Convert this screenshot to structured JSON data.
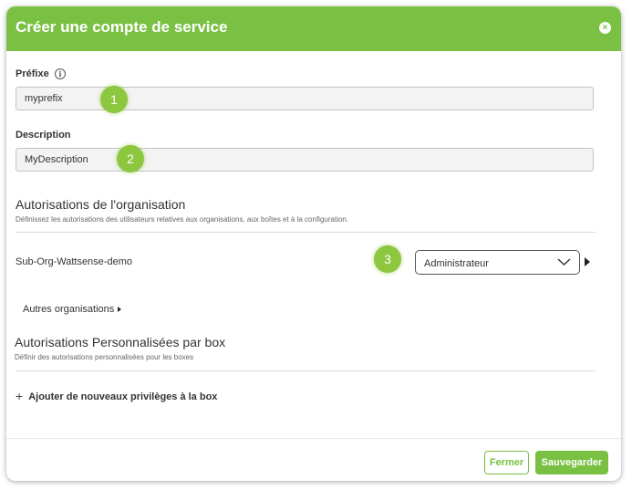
{
  "header": {
    "title": "Créer une compte de service",
    "close_icon": "close-icon",
    "close_symbol": "×",
    "accent_color": "#7ac143"
  },
  "prefix_field": {
    "label": "Préfixe",
    "info_symbol": "i",
    "value": "myprefix",
    "step": "1"
  },
  "description_field": {
    "label": "Description",
    "value": "MyDescription",
    "step": "2"
  },
  "org_permissions": {
    "title": "Autorisations de l'organisation",
    "subtitle": "Définissez les autorisations des utilisateurs relatives aux organisations, aux boîtes et à la configuration.",
    "org_name": "Sub-Org-Wattsense-demo",
    "role": "Administrateur",
    "step": "3",
    "other_orgs_label": "Autres organisations"
  },
  "box_permissions": {
    "title": "Autorisations Personnalisées par box",
    "subtitle": "Définir des autorisations personnalisées pour les boxes",
    "add_label": "Ajouter de nouveaux privilèges à la box",
    "add_symbol": "+"
  },
  "footer": {
    "close_label": "Fermer",
    "save_label": "Sauvegarder"
  }
}
